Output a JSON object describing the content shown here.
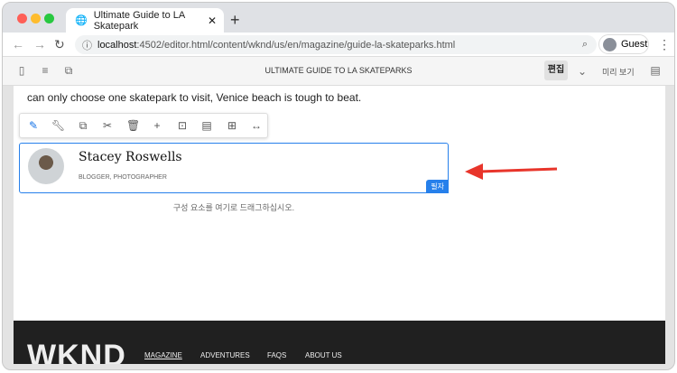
{
  "browser": {
    "tab_title": "Ultimate Guide to LA Skatepark",
    "url_host": "localhost",
    "url_rest": ":4502/editor.html/content/wknd/us/en/magazine/guide-la-skateparks.html",
    "profile": "Guest"
  },
  "editor": {
    "page_title": "ULTIMATE GUIDE TO LA SKATEPARKS",
    "edit": "편집",
    "preview": "미리 보기"
  },
  "content": {
    "intro": "can only choose one skatepark to visit, Venice beach is tough to beat.",
    "author_name": "Stacey Roswells",
    "author_role": "BLOGGER, PHOTOGRAPHER",
    "component_badge": "필자",
    "drop_hint": "구성 요소를 여기로 드래그하십시오."
  },
  "footer": {
    "logo": "WKND",
    "links": [
      "MAGAZINE",
      "ADVENTURES",
      "FAQS",
      "ABOUT US"
    ]
  },
  "colors": {
    "accent": "#2680eb",
    "arrow": "#e8352b"
  }
}
